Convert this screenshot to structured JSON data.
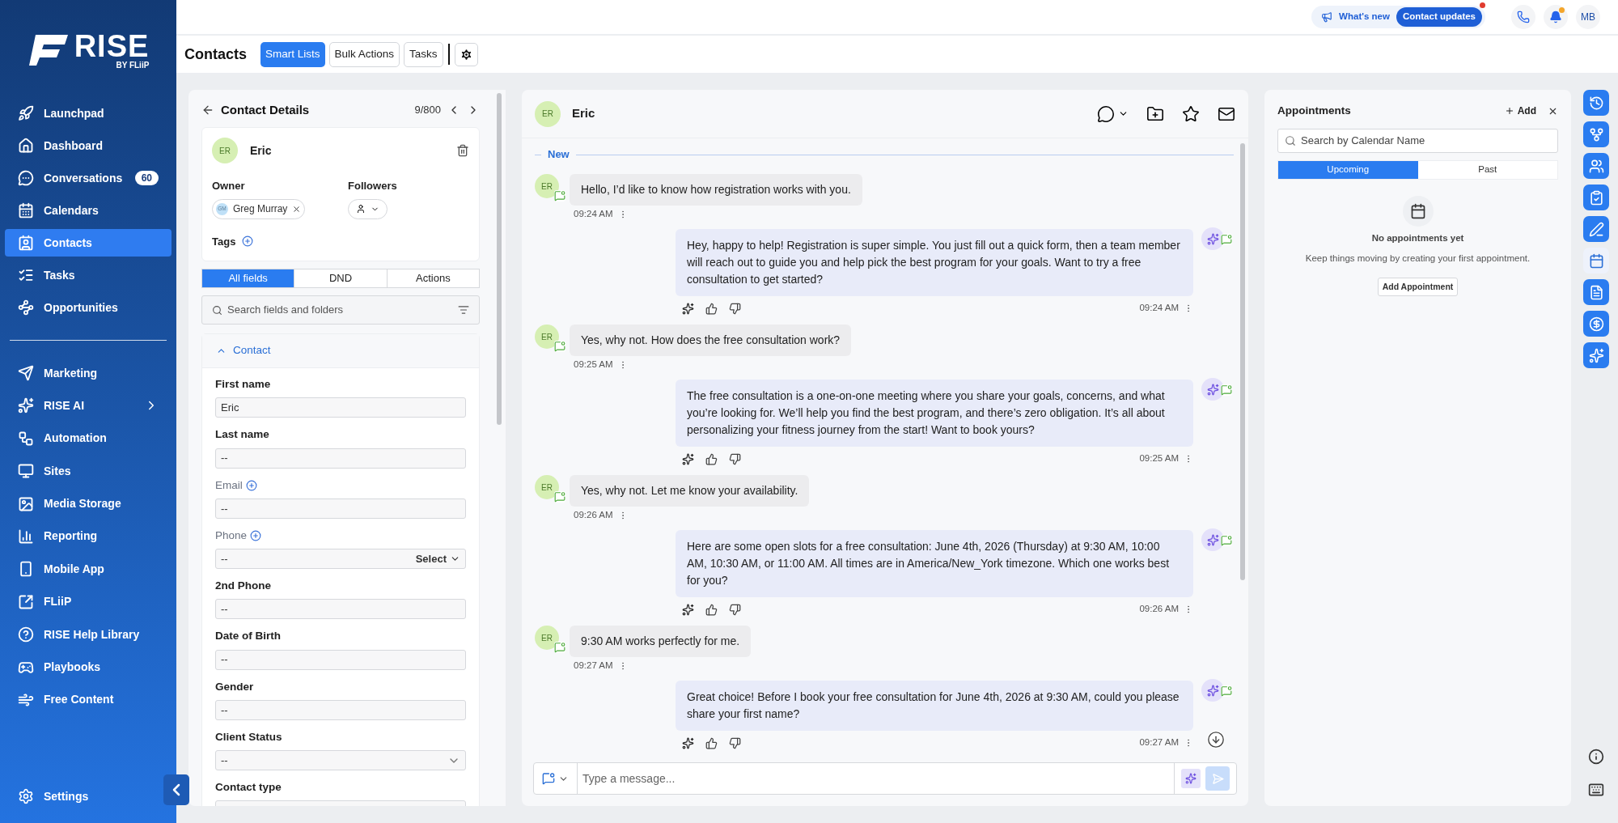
{
  "sidebar": {
    "logo": {
      "title": "RISE",
      "subtitle": "BY FLiiP"
    },
    "nav_primary": [
      {
        "label": "Launchpad",
        "selected": false
      },
      {
        "label": "Dashboard",
        "selected": false
      },
      {
        "label": "Conversations",
        "selected": false,
        "badge": "60"
      },
      {
        "label": "Calendars",
        "selected": false
      },
      {
        "label": "Contacts",
        "selected": true
      },
      {
        "label": "Tasks",
        "selected": false
      },
      {
        "label": "Opportunities",
        "selected": false
      }
    ],
    "nav_secondary": [
      {
        "label": "Marketing",
        "selected": false
      },
      {
        "label": "RISE AI",
        "selected": false,
        "has_submenu": true
      },
      {
        "label": "Automation",
        "selected": false
      },
      {
        "label": "Sites",
        "selected": false
      },
      {
        "label": "Media Storage",
        "selected": false
      },
      {
        "label": "Reporting",
        "selected": false
      },
      {
        "label": "Mobile App",
        "selected": false
      },
      {
        "label": "FLiiP",
        "selected": false
      },
      {
        "label": "RISE Help Library",
        "selected": false
      },
      {
        "label": "Playbooks",
        "selected": false
      },
      {
        "label": "Free Content",
        "selected": false
      }
    ],
    "settings": "Settings"
  },
  "topbar": {
    "whats_new": "What's new",
    "contact_updates": "Contact updates",
    "user_initials": "MB"
  },
  "header": {
    "title": "Contacts",
    "tabs": [
      {
        "label": "Smart Lists",
        "selected": true
      },
      {
        "label": "Bulk Actions",
        "selected": false
      },
      {
        "label": "Tasks",
        "selected": false
      }
    ]
  },
  "contact_details": {
    "title": "Contact Details",
    "counter": "9/800",
    "contact": {
      "initials": "ER",
      "name": "Eric"
    },
    "owner_label": "Owner",
    "owner": {
      "initials": "GM",
      "name": "Greg Murray"
    },
    "followers_label": "Followers",
    "tags_label": "Tags",
    "tabs": [
      {
        "label": "All fields",
        "selected": true
      },
      {
        "label": "DND",
        "selected": false
      },
      {
        "label": "Actions",
        "selected": false
      }
    ],
    "search": {
      "placeholder": "Search fields and folders"
    },
    "section": {
      "title": "Contact",
      "expanded": true
    },
    "fields": [
      {
        "label": "First name",
        "value": "Eric",
        "kind": "text",
        "addable": false
      },
      {
        "label": "Last name",
        "value": "--",
        "kind": "text",
        "addable": false
      },
      {
        "label": "Email",
        "value": "--",
        "kind": "text",
        "addable": true
      },
      {
        "label": "Phone",
        "value": "--",
        "kind": "phone",
        "addable": true,
        "select": "Select"
      },
      {
        "label": "2nd Phone",
        "value": "--",
        "kind": "text",
        "addable": false
      },
      {
        "label": "Date of Birth",
        "value": "--",
        "kind": "text",
        "addable": false
      },
      {
        "label": "Gender",
        "value": "--",
        "kind": "text",
        "addable": false
      },
      {
        "label": "Client Status",
        "value": "--",
        "kind": "select",
        "addable": false
      },
      {
        "label": "Contact type",
        "kind": "text",
        "addable": false
      }
    ]
  },
  "conversation": {
    "contact": {
      "initials": "ER",
      "name": "Eric"
    },
    "divider": "New",
    "messages": [
      {
        "kind": "inbound",
        "initials": "ER",
        "text": "Hello, I’d like to know how registration works with you.",
        "time": "09:24 AM"
      },
      {
        "kind": "outbound",
        "text": "Hey, happy to help! Registration is super simple. You just fill out a quick form, then a team member will reach out to guide you and help pick the best program for your goals. Want to try a free consultation to get started?",
        "time": "09:24 AM"
      },
      {
        "kind": "inbound",
        "initials": "ER",
        "text": "Yes, why not. How does the free consultation work?",
        "time": "09:25 AM"
      },
      {
        "kind": "outbound",
        "text": "The free consultation is a one-on-one meeting where you share your goals, concerns, and what you’re looking for. We’ll help you find the best program, and there’s zero obligation. It’s all about personalizing your fitness journey from the start! Want to book yours?",
        "time": "09:25 AM"
      },
      {
        "kind": "inbound",
        "initials": "ER",
        "text": "Yes, why not. Let me know your availability.",
        "time": "09:26 AM"
      },
      {
        "kind": "outbound",
        "text": "Here are some open slots for a free consultation: June 4th, 2026 (Thursday) at 9:30 AM, 10:00 AM, 10:30 AM, or 11:00 AM. All times are in America/New_York timezone. Which one works best for you?",
        "time": "09:26 AM"
      },
      {
        "kind": "inbound",
        "initials": "ER",
        "text": "9:30 AM works perfectly for me.",
        "time": "09:27 AM"
      },
      {
        "kind": "outbound",
        "text": "Great choice! Before I book your free consultation for June 4th, 2026 at 9:30 AM, could you please share your first name?",
        "time": "09:27 AM"
      }
    ],
    "composer": {
      "placeholder": "Type a message..."
    }
  },
  "appointments": {
    "title": "Appointments",
    "add": "Add",
    "search": {
      "placeholder": "Search by Calendar Name"
    },
    "tabs": [
      {
        "label": "Upcoming",
        "selected": true
      },
      {
        "label": "Past",
        "selected": false
      }
    ],
    "empty_title": "No appointments yet",
    "empty_text": "Keep things moving by creating your first appointment.",
    "button": "Add Appointment"
  },
  "right_rail": [
    {
      "selected": false
    },
    {
      "selected": false
    },
    {
      "selected": false
    },
    {
      "selected": false
    },
    {
      "selected": false
    },
    {
      "selected": true
    },
    {
      "selected": false
    },
    {
      "selected": false
    },
    {
      "selected": false
    }
  ]
}
